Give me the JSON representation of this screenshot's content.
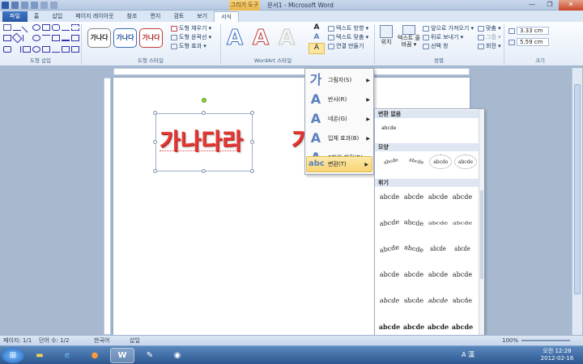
{
  "window": {
    "context_tab": "그리기 도구",
    "title": "문서1 - Microsoft Word",
    "controls": [
      "—",
      "❐",
      "✕"
    ]
  },
  "tabs": [
    {
      "label": "파일"
    },
    {
      "label": "홈"
    },
    {
      "label": "삽입"
    },
    {
      "label": "페이지 레이아웃"
    },
    {
      "label": "참조"
    },
    {
      "label": "편지"
    },
    {
      "label": "검토"
    },
    {
      "label": "보기"
    },
    {
      "label": "서식"
    }
  ],
  "ribbon": {
    "groups": {
      "shape_insert": "도형 삽입",
      "shape_style": "도형 스타일",
      "wordart_style": "WordArt 스타일",
      "arrange": "정렬",
      "size": "크기"
    },
    "shape_style_samples": [
      "가나다",
      "가나다",
      "가나다"
    ],
    "shape_commands": {
      "fill": "도형 채우기 ▾",
      "outline": "도형 윤곽선 ▾",
      "effects": "도형 효과 ▾"
    },
    "wordart_sample": "A",
    "text_commands": {
      "direction": "텍스트 방향 ▾",
      "align": "텍스트 맞춤 ▾",
      "link": "연결 만들기"
    },
    "arrange": {
      "position": "위치",
      "wrap": "텍스트 줄 바꿈 ▾",
      "bring_forward": "앞으로 가져오기 ▾",
      "send_backward": "뒤로 보내기 ▾",
      "selection_pane": "선택 창",
      "align": "맞춤 ▾",
      "group": "그룹 ▾",
      "rotate": "회전 ▾"
    },
    "size": {
      "height": "3.33 cm",
      "width": "5.59 cm"
    }
  },
  "document": {
    "wordart_text": "가나다라",
    "wordart_text_partial": "가"
  },
  "text_effects_menu": {
    "items": [
      {
        "label": "그림자(S)"
      },
      {
        "label": "반사(R)"
      },
      {
        "label": "네온(G)"
      },
      {
        "label": "입체 효과(B)"
      },
      {
        "label": "3차원 회전(D)"
      },
      {
        "label": "변환(T)"
      }
    ]
  },
  "transform_submenu": {
    "no_transform_header": "변환 없음",
    "no_transform_sample": "abcde",
    "path_header": "모양",
    "warp_header": "휘기",
    "sample_text": "abcde"
  },
  "status": {
    "page": "페이지: 1/1",
    "words": "단어 수: 1/2",
    "language": "한국어",
    "insert": "삽입",
    "zoom": "100%"
  },
  "taskbar": {
    "time": "오전 12:28",
    "date": "2012-02-16",
    "ime": "A 漢"
  }
}
